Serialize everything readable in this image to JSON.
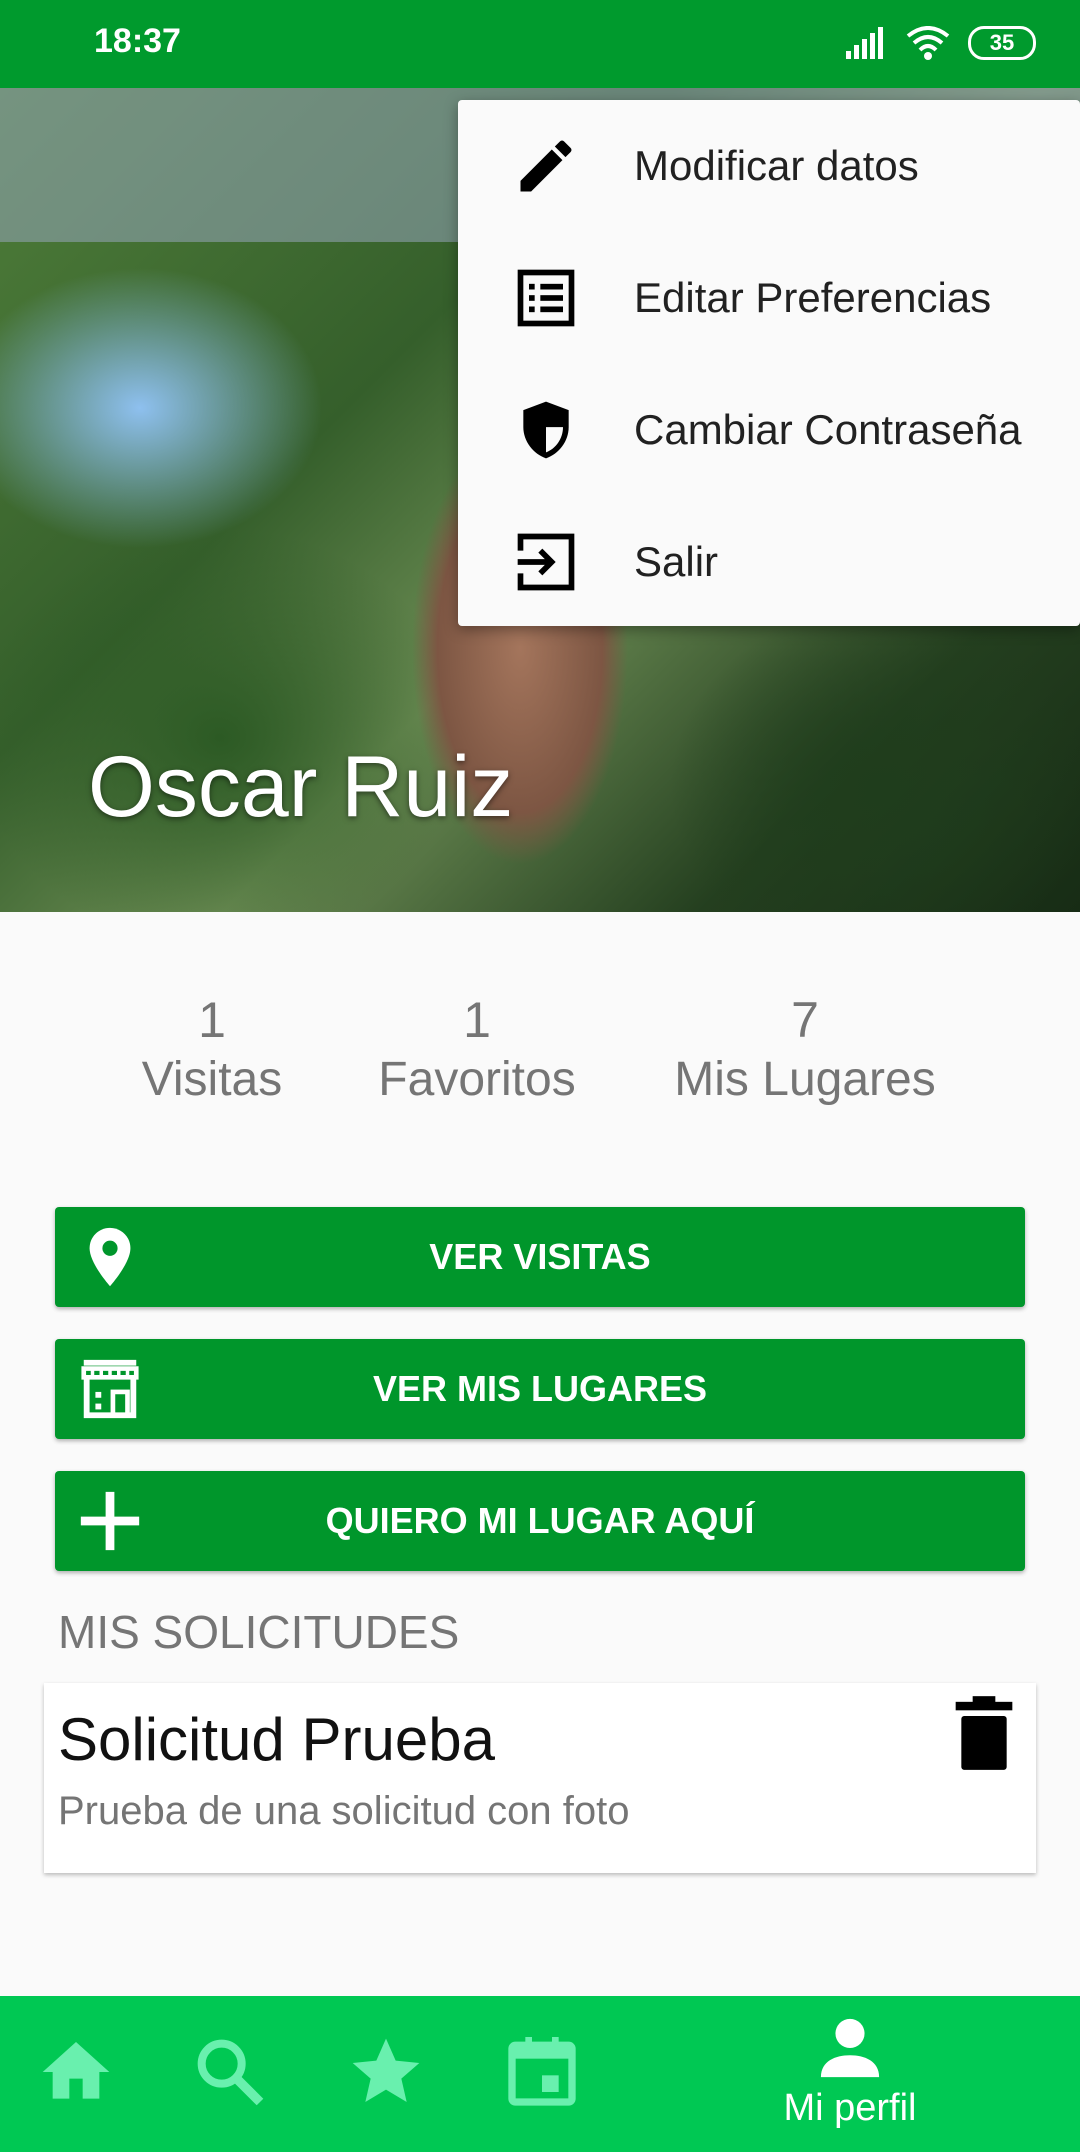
{
  "status_bar": {
    "time": "18:37",
    "battery": "35"
  },
  "profile": {
    "name": "Oscar Ruiz"
  },
  "menu": {
    "items": [
      {
        "label": "Modificar datos",
        "icon": "pencil-icon"
      },
      {
        "label": "Editar Preferencias",
        "icon": "list-icon"
      },
      {
        "label": "Cambiar Contraseña",
        "icon": "shield-icon"
      },
      {
        "label": "Salir",
        "icon": "exit-icon"
      }
    ]
  },
  "stats": [
    {
      "value": "1",
      "label": "Visitas"
    },
    {
      "value": "1",
      "label": "Favoritos"
    },
    {
      "value": "7",
      "label": "Mis Lugares"
    }
  ],
  "buttons": {
    "ver_visitas": "VER VISITAS",
    "ver_mis_lugares": "VER MIS LUGARES",
    "quiero_mi_lugar": "QUIERO MI LUGAR AQUÍ"
  },
  "solicitudes": {
    "title": "MIS SOLICITUDES",
    "items": [
      {
        "title": "Solicitud Prueba",
        "description": "Prueba de una solicitud con foto"
      }
    ]
  },
  "bottom_nav": {
    "active_label": "Mi perfil",
    "icons": [
      "home-icon",
      "search-icon",
      "star-icon",
      "calendar-icon",
      "person-icon"
    ]
  },
  "colors": {
    "status_bar": "#009a2d",
    "button": "#00962b",
    "bottom_nav": "#00c853",
    "nav_icon_inactive": "#69f0ae"
  }
}
